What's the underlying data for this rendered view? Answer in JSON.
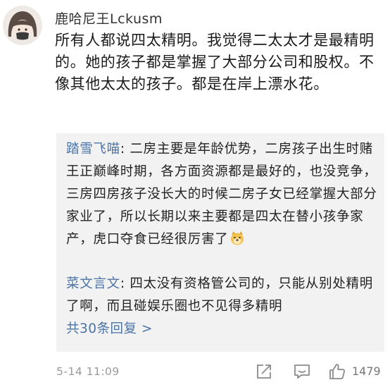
{
  "post": {
    "username": "鹿哈尼王Lckusm",
    "text": "所有人都说四太精明。我觉得二太太才是最精明的。她的孩子都是掌握了大部分公司和股权。不像其他太太的孩子。都是在岸上漂水花。"
  },
  "replies": [
    {
      "author": "踏雪飞喵",
      "separator": ": ",
      "text": "二房主要是年龄优势，二房孩子出生时赌王正巅峰时期，各方面资源都是最好的，也没竞争，三房四房孩子没长大的时候二房子女已经掌握大部分家业了，所以长期以来主要都是四太在替小孩争家产，虎口夺食已经很厉害了",
      "emoji": "doge-emoji-icon"
    },
    {
      "author": "菜文言文",
      "separator": ": ",
      "text": "四太没有资格管公司的，只能从别处精明了啊，而且碰娱乐圈也不见得多精明"
    }
  ],
  "more_replies": "共30条回复 >",
  "footer": {
    "timestamp": "5-14 11:09",
    "like_count": "1479",
    "icons": [
      "share-icon",
      "comment-icon",
      "thumbs-up-icon"
    ]
  },
  "colors": {
    "link": "#4b73a6",
    "reply_background": "#f2f2f2",
    "meta": "#9a9a9a"
  }
}
